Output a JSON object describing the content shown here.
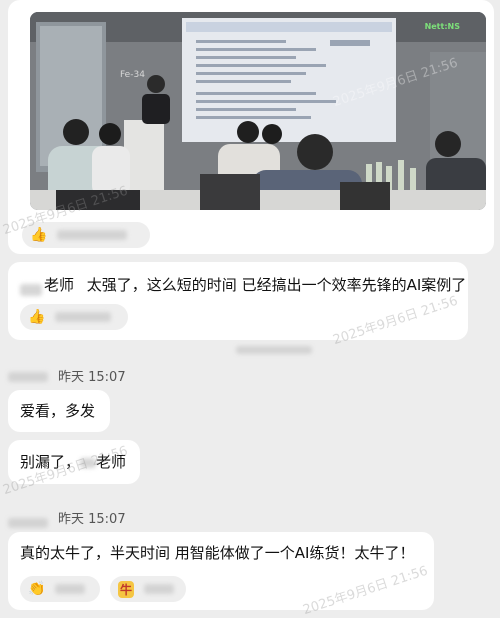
{
  "photo": {
    "room_sign": "Fe-34",
    "corner_badge": "Nett:NS",
    "watermark": "2025年9月6日 21:56"
  },
  "messages": [
    {
      "sender_suffix": "老师",
      "text": "太强了，这么短的时间 已经搞出一个效率先锋的AI案例了"
    },
    {
      "text": "爱看，多发"
    },
    {
      "prefix": "别漏了",
      "suffix": "老师"
    },
    {
      "text": "真的太牛了，半天时间 用智能体做了一个AI练货！太牛了！"
    }
  ],
  "timestamps": [
    "昨天 15:07",
    "昨天 15:07"
  ],
  "reactions": {
    "thumbs": "👍",
    "clap": "👏",
    "niu": "牛"
  },
  "watermarks": [
    "2025年9月6日 21:56",
    "2025年9月6日 21:56",
    "2025年9月6日 21:56",
    "2025年9月6日 21:56"
  ],
  "colors": {
    "background": "#ededed",
    "bubble": "#ffffff",
    "reaction_bg": "#eeeeee"
  }
}
